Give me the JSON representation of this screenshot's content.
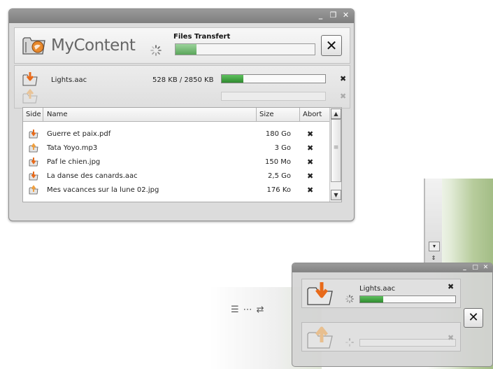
{
  "app": {
    "logo_text": "MyContent",
    "window_buttons": [
      "_",
      "❐",
      "✕"
    ]
  },
  "transfer": {
    "label": "Files Transfert",
    "progress": 0.15
  },
  "active": {
    "current": {
      "direction": "download",
      "name": "Lights.aac",
      "size": "528 KB / 2850 KB",
      "progress": 0.21
    },
    "upload": {
      "direction": "upload",
      "progress": 0
    }
  },
  "table": {
    "columns": [
      "Side",
      "Name",
      "Size",
      "Abort"
    ],
    "rows": [
      {
        "side": "download",
        "name": "Guerre et paix.pdf",
        "size": "180 Go"
      },
      {
        "side": "upload",
        "name": "Tata Yoyo.mp3",
        "size": "3 Go"
      },
      {
        "side": "download",
        "name": "Paf le chien.jpg",
        "size": "150 Mo"
      },
      {
        "side": "download",
        "name": "La danse des canards.aac",
        "size": "2,5 Go"
      },
      {
        "side": "upload",
        "name": "Mes vacances sur la lune 02.jpg",
        "size": "176 Ko"
      }
    ]
  },
  "mini": {
    "download": {
      "name": "Lights.aac",
      "progress": 0.24
    },
    "upload": {
      "progress": 0
    }
  },
  "icons": {
    "abort": "✖",
    "close": "✕",
    "scroll_up": "▲",
    "scroll_down": "▼",
    "thumb_grip": "≡"
  },
  "colors": {
    "progress_green": "#3a9a3a",
    "download_arrow": "#e86a1a",
    "upload_arrow": "#f0a040"
  }
}
